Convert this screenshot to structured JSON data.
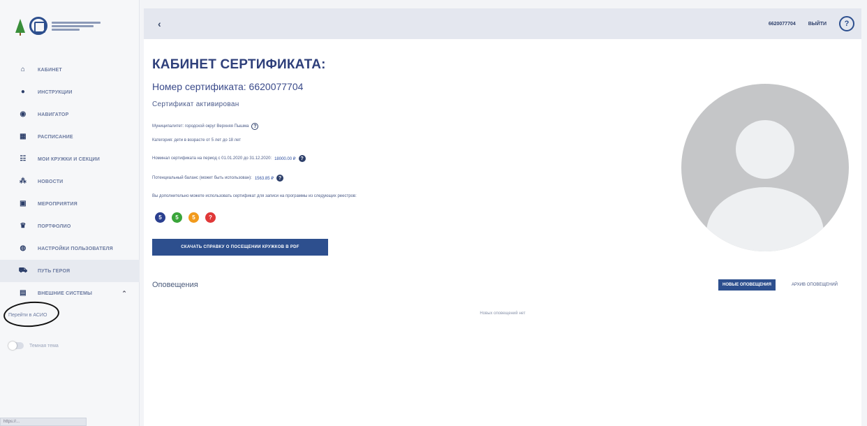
{
  "sidebar": {
    "items": [
      {
        "label": "КАБИНЕТ",
        "icon": "home-icon",
        "glyph": "⌂"
      },
      {
        "label": "ИНСТРУКЦИИ",
        "icon": "info-icon",
        "glyph": "●"
      },
      {
        "label": "НАВИГАТОР",
        "icon": "compass-icon",
        "glyph": "◉"
      },
      {
        "label": "РАСПИСАНИЕ",
        "icon": "calendar-icon",
        "glyph": "▦"
      },
      {
        "label": "МОИ КРУЖКИ И СЕКЦИИ",
        "icon": "list-icon",
        "glyph": "☷"
      },
      {
        "label": "НОВОСТИ",
        "icon": "news-icon",
        "glyph": "⁂"
      },
      {
        "label": "МЕРОПРИЯТИЯ",
        "icon": "event-icon",
        "glyph": "▣"
      },
      {
        "label": "ПОРТФОЛИО",
        "icon": "trophy-icon",
        "glyph": "♛"
      },
      {
        "label": "НАСТРОЙКИ ПОЛЬЗОВАТЕЛЯ",
        "icon": "user-settings-icon",
        "glyph": "◍"
      },
      {
        "label": "ПУТЬ ГЕРОЯ",
        "icon": "car-icon",
        "glyph": "⛟"
      },
      {
        "label": "ВНЕШНИЕ СИСТЕМЫ",
        "icon": "external-icon",
        "glyph": "▤"
      }
    ],
    "sub_item": "Перейти в АСИО",
    "theme_label": "Темная тема",
    "status_url": "https://..."
  },
  "topbar": {
    "back": "‹",
    "cert_id": "6620077704",
    "logout": "ВЫЙТИ",
    "help": "?"
  },
  "main": {
    "title": "КАБИНЕТ СЕРТИФИКАТА:",
    "cert_number": "Номер сертификата: 6620077704",
    "status": "Сертификат активирован",
    "municipality": "Муниципалитет: городской округ Верхняя Пышма",
    "category": "Категория: дети в возрасте от 5 лет до 18 лет",
    "nominal_prefix": "Номинал сертификата на период с 01.01.2020 до 31.12.2020:",
    "nominal_value": "18000.00 ₽",
    "balance_prefix": "Потенциальный баланс (может быть использован):",
    "balance_value": "1563.85 ₽",
    "registries_text": "Вы дополнительно можете использовать сертификат для записи на программы из следующих реестров:",
    "badges": [
      {
        "label": "5",
        "color": "#2a3f8f"
      },
      {
        "label": "5",
        "color": "#3aa53a"
      },
      {
        "label": "5",
        "color": "#f19a1c"
      },
      {
        "label": "?",
        "color": "#e03838"
      }
    ],
    "pdf_button": "СКАЧАТЬ СПРАВКУ О ПОСЕЩЕНИИ КРУЖКОВ В PDF",
    "notifications_title": "Оповещения",
    "notif_new": "НОВЫЕ ОПОВЕЩЕНИЯ",
    "notif_archive": "АРХИВ ОПОВЕЩЕНИЙ",
    "no_notifications": "Новых оповещений нет"
  },
  "colors": {
    "accent": "#2d4f8e",
    "title": "#2e3f7a",
    "topbar": "#e4e7ef"
  }
}
